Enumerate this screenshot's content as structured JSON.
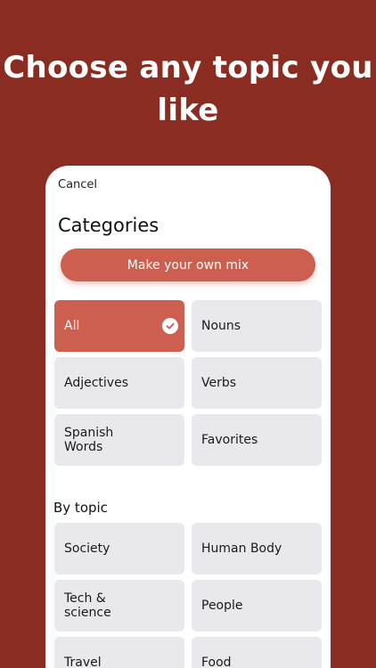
{
  "headline": "Choose any topic you like",
  "cancel_label": "Cancel",
  "categories_title": "Categories",
  "mix_button_label": "Make your own mix",
  "categories": [
    {
      "label": "All",
      "selected": true
    },
    {
      "label": "Nouns",
      "selected": false
    },
    {
      "label": "Adjectives",
      "selected": false
    },
    {
      "label": "Verbs",
      "selected": false
    },
    {
      "label": "Spanish\nWords",
      "selected": false
    },
    {
      "label": "Favorites",
      "selected": false
    }
  ],
  "by_topic_title": "By topic",
  "topics": [
    {
      "label": "Society"
    },
    {
      "label": "Human Body"
    },
    {
      "label": "Tech &\nscience"
    },
    {
      "label": "People"
    },
    {
      "label": "Travel"
    },
    {
      "label": "Food"
    }
  ],
  "colors": {
    "background": "#8b2c22",
    "accent": "#cc5f50",
    "tile": "#e9e8ed"
  }
}
